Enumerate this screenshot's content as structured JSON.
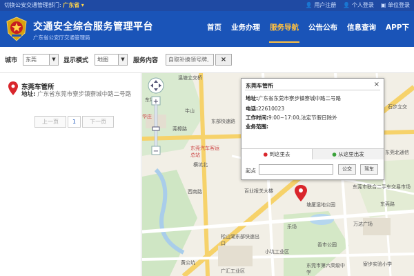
{
  "topbar": {
    "switch_label": "切换公安交通管理部门:",
    "province": "广东省",
    "links": [
      "用户注册",
      "个人登录",
      "单位登录"
    ]
  },
  "header": {
    "title": "交通安全综合服务管理平台",
    "subtitle": "广东省公安厅交通管理局",
    "nav": [
      "首页",
      "业务办理",
      "服务导航",
      "公告公布",
      "信息查询",
      "APP下"
    ],
    "active_nav": "服务导航"
  },
  "filter": {
    "city_label": "城市",
    "city_value": "东莞",
    "mode_label": "显示模式",
    "mode_value": "地图",
    "content_label": "服务内容",
    "content_value": "自取补换领号牌,",
    "clear_label": "×"
  },
  "result": {
    "name": "东莞车管所",
    "addr_label": "地址:",
    "addr_value": "广东省东莞市寮步镇寮城中路二号路",
    "pager_prev": "上一页",
    "pager_current": "1",
    "pager_next": "下一页"
  },
  "infowindow": {
    "title": "东莞车管所",
    "close": "×",
    "address_label": "地址:",
    "address_value": "广东省东莞市寮步镇寮城中路二号路",
    "phone_label": "电话:",
    "phone_value": "22610023",
    "hours_label": "工作时间:",
    "hours_value": "9:00~17:00,法定节假日除外",
    "scope_label": "业务范围:",
    "tab_to": "到这里去",
    "tab_from": "从这里出发",
    "start_label": "起点",
    "bus_button": "公交",
    "drive_button": "驾车"
  },
  "map_labels": {
    "l1": "温塘立交桥",
    "l2": "东坑",
    "l3": "华庄",
    "l4": "牛山",
    "l5": "东部快速路",
    "l6": "东莞汽车客运总站",
    "l7": "横坑北",
    "l8": "莞樟路",
    "l9": "百业报关大楼",
    "l10": "东莞市联合二手车交易市场",
    "l11": "西南路",
    "l12": "塘厦湿地公园",
    "l13": "松山湖东部快速出口",
    "l14": "香市公园",
    "l15": "黄公坑",
    "l16": "小坑工业区",
    "l17": "东莞市第六高级中学",
    "l18": "广汇工业区",
    "l19": "寮步实验小学",
    "l20": "万达广场",
    "l21": "乐场",
    "l22": "石步立交",
    "l23": "东莞北通信",
    "l24": "东莞路"
  },
  "colors": {
    "topbar_bg": "#1f4aa3",
    "header_bg": "#1a54b8",
    "nav_active": "#ffc040",
    "pin": "#d9262c"
  },
  "icons": [
    "police-emblem-icon",
    "map-pin-icon",
    "close-icon",
    "pan-control-icon",
    "zoom-in-icon",
    "zoom-out-icon"
  ]
}
